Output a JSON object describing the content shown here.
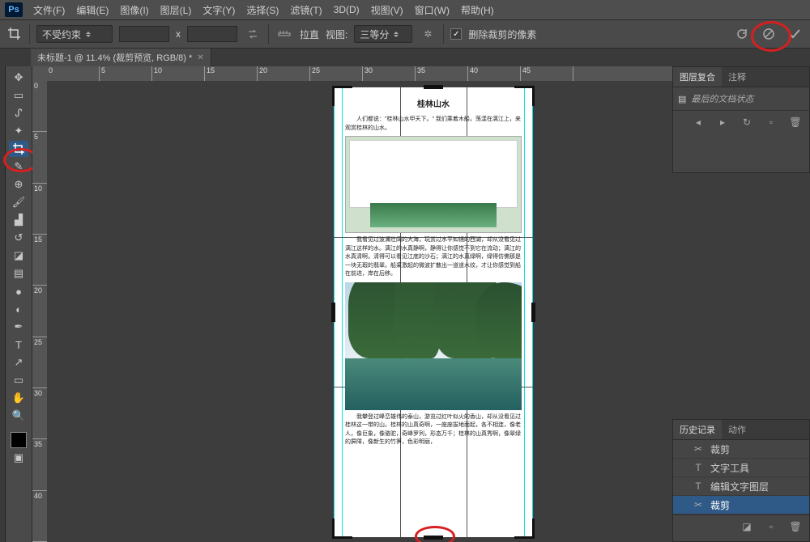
{
  "menu": {
    "logo": "Ps",
    "items": [
      "文件(F)",
      "编辑(E)",
      "图像(I)",
      "图层(L)",
      "文字(Y)",
      "选择(S)",
      "滤镜(T)",
      "3D(D)",
      "视图(V)",
      "窗口(W)",
      "帮助(H)"
    ]
  },
  "options": {
    "ratio": "不受约束",
    "x_sep": "x",
    "straighten": "拉直",
    "view_label": "视图:",
    "view_value": "三等分",
    "delete_cropped": "删除裁剪的像素"
  },
  "doc_tab": "未标题-1 @ 11.4% (裁剪预览, RGB/8) *",
  "ruler_h": [
    "0",
    "5",
    "10",
    "15",
    "20",
    "25",
    "30",
    "35",
    "40",
    "45"
  ],
  "ruler_v": [
    "0",
    "5",
    "10",
    "15",
    "20",
    "25",
    "30",
    "35",
    "40"
  ],
  "document": {
    "title": "桂林山水",
    "p1": "人们都说：\"桂林山水甲天下。\" 我们乘着木船，荡漾在漓江上，来观赏桂林的山水。",
    "p2": "我看见过波澜壮阔的大海，玩赏过水平如镜的西湖，却从没看见过漓江这样的水。漓江的水真静啊，静得让你感觉不到它在流动；漓江的水真清啊，清得可以看见江底的沙石；漓江的水真绿啊，绿得仿佛那是一块无瑕的翡翠。船桨激起的微波扩散出一道道水纹，才让你感觉到船在前进，岸在后移。",
    "p3": "我攀登过峰峦雄伟的泰山，游览过红叶似火的香山，却从没看见过桂林这一带的山。桂林的山真奇啊，一座座拔地而起，各不相连，像老人，像巨象，像骆驼，奇峰罗列，形态万千；桂林的山真秀啊，像翠绿的屏障，像新生的竹笋，色彩明丽，"
  },
  "panel1": {
    "tab1": "图层复合",
    "tab2": "注释",
    "state": "最后的文档状态"
  },
  "panel2": {
    "tab1": "历史记录",
    "tab2": "动作",
    "items": [
      {
        "icon": "crop",
        "label": "裁剪"
      },
      {
        "icon": "T",
        "label": "文字工具"
      },
      {
        "icon": "T",
        "label": "编辑文字图层"
      },
      {
        "icon": "crop",
        "label": "裁剪",
        "sel": true
      }
    ]
  }
}
